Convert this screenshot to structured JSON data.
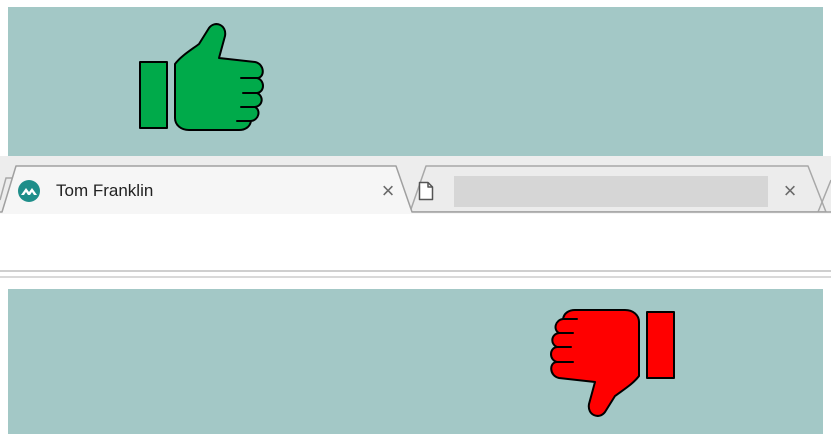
{
  "icons": {
    "thumbs_up": "thumbs-up-icon",
    "thumbs_down": "thumbs-down-icon",
    "favicon": "site-favicon-icon",
    "page": "blank-page-icon",
    "close": "close-icon"
  },
  "colors": {
    "panel_background": "#a3c8c6",
    "thumbs_up": "#00aa4a",
    "thumbs_down": "#ff0000",
    "favicon": "#1f8e8a"
  },
  "tabs": [
    {
      "title": "Tom Franklin",
      "close_glyph": "×",
      "active": true
    },
    {
      "title": "",
      "close_glyph": "×",
      "active": false
    }
  ]
}
